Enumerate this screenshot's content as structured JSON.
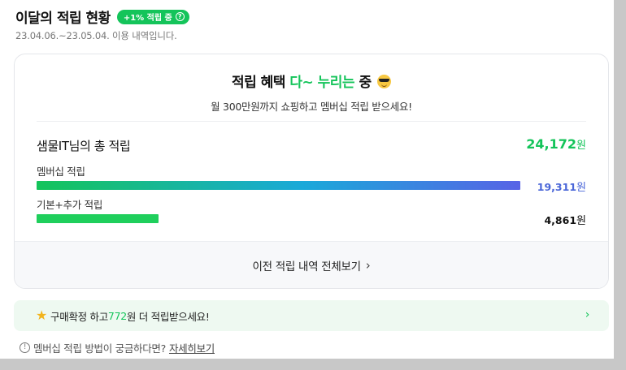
{
  "header": {
    "title": "이달의 적립 현황",
    "badge": "+1% 적립 중",
    "badge_icon": "question-circle-icon",
    "period": "23.04.06.~23.05.04. 이용 내역입니다."
  },
  "card": {
    "headline_prefix": "적립 혜택 ",
    "headline_accent": "다~ 누리는",
    "headline_suffix": " 중",
    "headline_emoji": "sunglasses-emoji-icon",
    "subtitle": "월 300만원까지 쇼핑하고 멤버십 적립 받으세요!",
    "total_label": "샘물IT님의 총 적립",
    "total_amount": "24,172",
    "currency": "원",
    "rows": [
      {
        "label": "멤버십 적립",
        "amount": "19,311",
        "share": 0.799
      },
      {
        "label": "기본+추가 적립",
        "amount": "4,861",
        "share": 0.201
      }
    ],
    "footer_link": "이전 적립 내역 전체보기"
  },
  "banner": {
    "text_before": "구매확정 하고 ",
    "amount": "772",
    "text_after": "원 더 적립받으세요!",
    "icon": "star-icon"
  },
  "help": {
    "text": "멤버십 적립 방법이 궁금하다면?",
    "link": "자세히보기",
    "icon": "info-icon"
  },
  "colors": {
    "accent_green": "#14c45a",
    "member_blue": "#4a66d8",
    "gradient": [
      "#14c45a",
      "#1aa9d9",
      "#5863e6"
    ]
  }
}
